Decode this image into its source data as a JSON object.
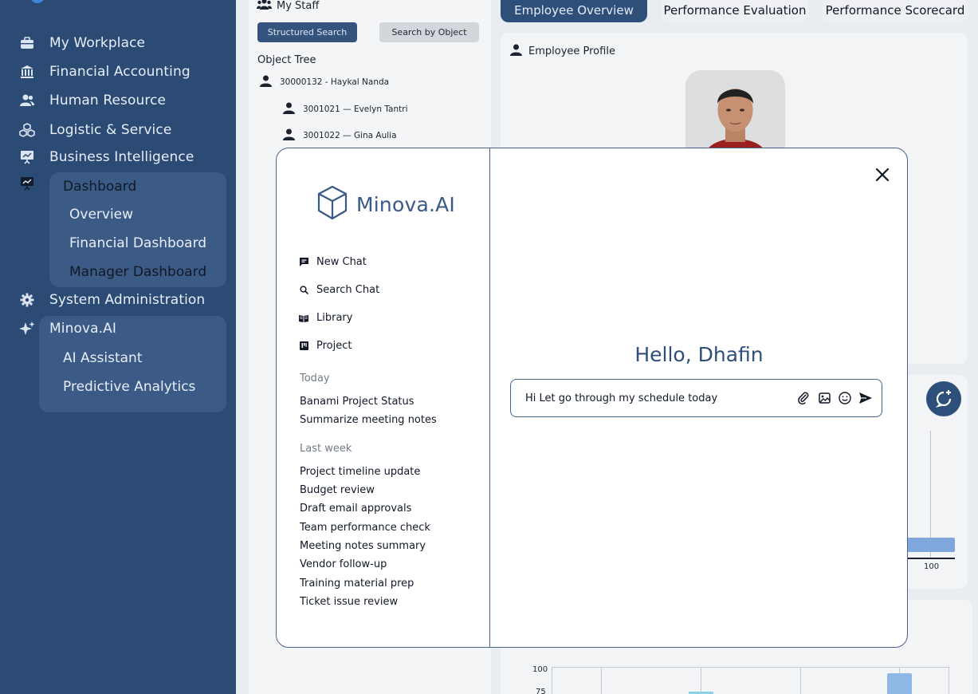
{
  "sidebar": {
    "items": [
      {
        "label": "My Workplace",
        "icon": "briefcase-icon"
      },
      {
        "label": "Financial Accounting",
        "icon": "bank-icon"
      },
      {
        "label": "Human Resource",
        "icon": "people-icon"
      },
      {
        "label": "Logistic & Service",
        "icon": "cubes-icon"
      },
      {
        "label": "Business Intelligence",
        "icon": "presentation-icon"
      },
      {
        "label": "System Administration",
        "icon": "gear-icon"
      },
      {
        "label": "Minova.AI",
        "icon": "sparkle-icon"
      }
    ],
    "dashboard": {
      "label": "Dashboard",
      "children": [
        "Overview",
        "Financial Dashboard",
        "Manager Dashboard"
      ]
    },
    "ai": {
      "children": [
        "AI Assistant",
        "Predictive Analytics"
      ]
    }
  },
  "staff": {
    "title": "My Staff",
    "structured_search": "Structured Search",
    "search_by_object": "Search by Object",
    "object_tree_label": "Object Tree",
    "tree": [
      "30000132 - Haykal Nanda",
      "3001021 — Evelyn Tantri",
      "3001022 — Gina Aulia"
    ]
  },
  "tabs": [
    "Employee Overview",
    "Performance Evaluation",
    "Performance Scorecard"
  ],
  "profile": {
    "title": "Employee Profile"
  },
  "bg_chart": {
    "tick_100": "100",
    "tick_75": "75",
    "axis_100": "100"
  },
  "modal": {
    "brand": "Minova.AI",
    "menu": [
      {
        "label": "New Chat",
        "icon": "chat-icon"
      },
      {
        "label": "Search Chat",
        "icon": "search-icon"
      },
      {
        "label": "Library",
        "icon": "book-icon"
      },
      {
        "label": "Project",
        "icon": "project-icon"
      }
    ],
    "today_label": "Today",
    "today": [
      "Banami Project Status",
      "Summarize meeting notes"
    ],
    "last_week_label": "Last week",
    "last_week": [
      "Project timeline update",
      "Budget review",
      "Draft email approvals",
      "Team performance check",
      "Meeting notes summary",
      "Vendor follow-up",
      "Training material prep",
      "Ticket issue review"
    ],
    "greeting": "Hello, Dhafin",
    "input_value": "Hi Let go through my schedule today"
  },
  "colors": {
    "sidebar": "#2b4a74",
    "accent": "#2f4f7b",
    "modal_border": "#46648e"
  }
}
